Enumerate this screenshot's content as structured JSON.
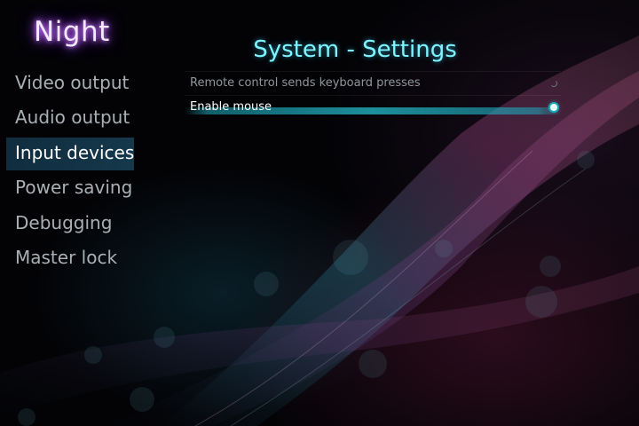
{
  "app": {
    "logo_text": "Night"
  },
  "header": {
    "title": "System - Settings"
  },
  "sidebar": {
    "items": [
      {
        "label": "Video output",
        "active": false
      },
      {
        "label": "Audio output",
        "active": false
      },
      {
        "label": "Input devices",
        "active": true
      },
      {
        "label": "Power saving",
        "active": false
      },
      {
        "label": "Debugging",
        "active": false
      },
      {
        "label": "Master lock",
        "active": false
      }
    ]
  },
  "settings": {
    "rows": [
      {
        "label": "Remote control sends keyboard presses",
        "enabled": false
      },
      {
        "label": "Enable mouse",
        "enabled": true,
        "focused": true
      }
    ]
  },
  "colors": {
    "accent": "#7ff4ff",
    "highlight": "#23bece",
    "sidebar_active": "#15384b",
    "logo_glow": "#b04cff"
  }
}
